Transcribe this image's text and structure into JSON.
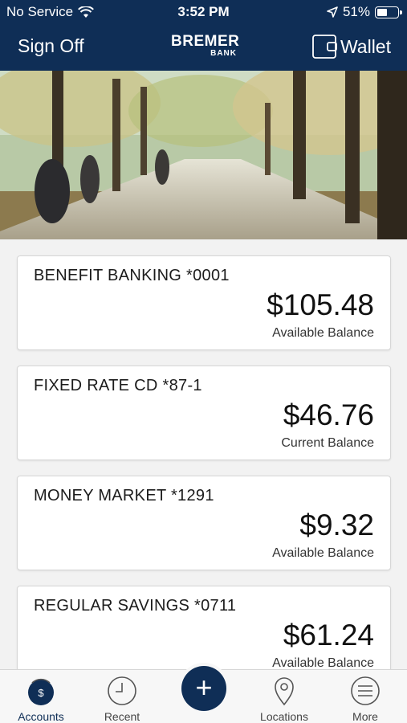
{
  "status_bar": {
    "carrier": "No Service",
    "time": "3:52 PM",
    "battery": "51%",
    "battery_level": 0.51
  },
  "header": {
    "sign_off": "Sign Off",
    "logo_top": "BREMER",
    "logo_bottom": "BANK",
    "wallet": "Wallet"
  },
  "accounts": [
    {
      "name": "BENEFIT BANKING *0001",
      "amount": "$105.48",
      "label": "Available Balance"
    },
    {
      "name": "FIXED RATE CD *87-1",
      "amount": "$46.76",
      "label": "Current Balance"
    },
    {
      "name": "MONEY MARKET *1291",
      "amount": "$9.32",
      "label": "Available Balance"
    },
    {
      "name": "REGULAR SAVINGS *0711",
      "amount": "$61.24",
      "label": "Available Balance"
    }
  ],
  "tabs": {
    "accounts": "Accounts",
    "recent": "Recent",
    "add": "+",
    "locations": "Locations",
    "more": "More"
  },
  "colors": {
    "brand": "#0f2e56",
    "background": "#f2f2f2"
  }
}
